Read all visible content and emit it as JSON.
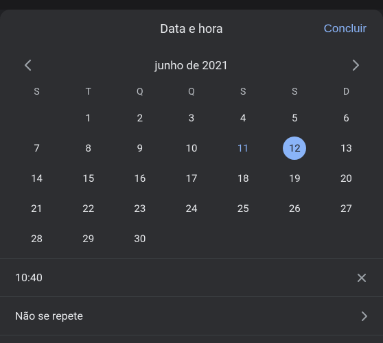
{
  "header": {
    "title": "Data e hora",
    "done_label": "Concluir"
  },
  "calendar": {
    "month_label": "junho de 2021",
    "weekdays": [
      "S",
      "T",
      "Q",
      "Q",
      "S",
      "S",
      "D"
    ],
    "today_day": 11,
    "selected_day": 12,
    "start_offset": 1,
    "days_in_month": 30
  },
  "time_row": {
    "value": "10:40"
  },
  "repeat_row": {
    "label": "Não se repete"
  }
}
